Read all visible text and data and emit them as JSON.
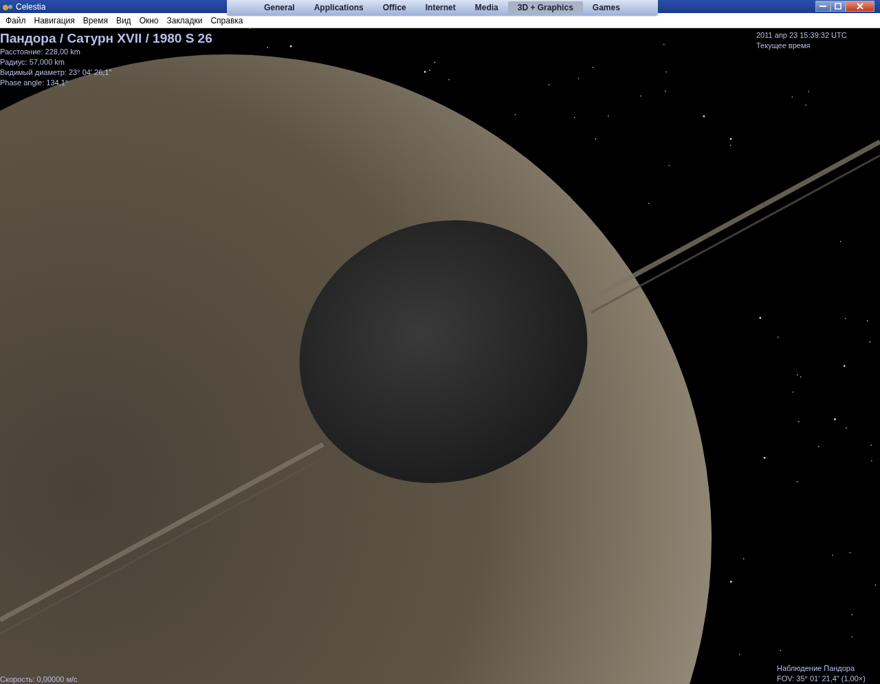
{
  "window": {
    "title": "Celestia"
  },
  "launcher": {
    "tabs": [
      {
        "label": "General",
        "selected": false
      },
      {
        "label": "Applications",
        "selected": false
      },
      {
        "label": "Office",
        "selected": false
      },
      {
        "label": "Internet",
        "selected": false
      },
      {
        "label": "Media",
        "selected": false
      },
      {
        "label": "3D + Graphics",
        "selected": true
      },
      {
        "label": "Games",
        "selected": false
      }
    ]
  },
  "menu": [
    "Файл",
    "Навигация",
    "Время",
    "Вид",
    "Окно",
    "Закладки",
    "Справка"
  ],
  "object_info": {
    "title": "Пандора / Сатурн XVII / 1980 S 26",
    "lines": [
      "Расстояние: 228,00 km",
      "Радиус: 57,000 km",
      "Видимый диаметр: 23° 04' 26,1\"",
      "Phase angle: 134,1°"
    ]
  },
  "time_info": {
    "datetime": "2011 апр 23 15:39:32 UTC",
    "mode": "Текущее время"
  },
  "speed": "Скорость: 0,00000 м/с",
  "view_info": {
    "observing": "Наблюдение Пандора",
    "fov": "FOV: 35° 01' 21,4\" (1,00×)"
  }
}
